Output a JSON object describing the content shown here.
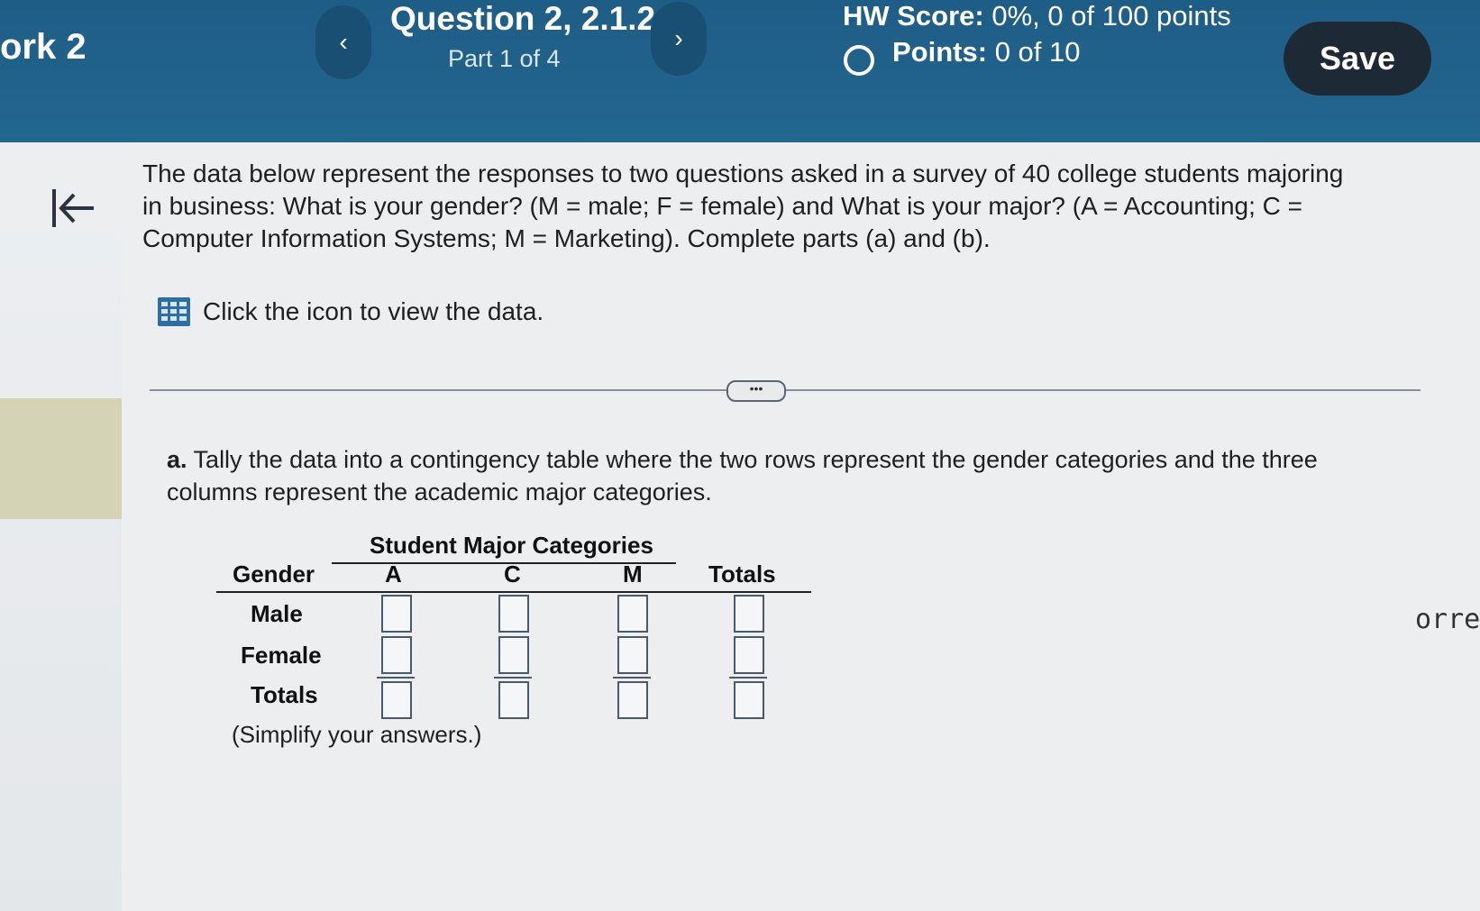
{
  "header": {
    "hw_name": "ork 2",
    "question_title": "Question 2, 2.1.2",
    "part": "Part 1 of 4",
    "hw_score_label": "HW Score:",
    "hw_score_value": "0%, 0 of 100 points",
    "points_label": "Points:",
    "points_value": "0 of 10",
    "save_label": "Save",
    "prev_label": "‹",
    "next_label": "›"
  },
  "question": {
    "intro": "The data below represent the responses to two questions asked in a survey of 40 college students majoring in business: What is your gender? (M = male; F = female) and What is your major? (A = Accounting; C = Computer Information Systems; M = Marketing). Complete parts (a) and (b).",
    "data_link": "Click the icon to view the data.",
    "expand_label": "•••",
    "part_a_letter": "a.",
    "part_a_text": "Tally the data into a contingency table where the two rows represent the gender categories and the three columns represent the academic major categories.",
    "simplify": "(Simplify your answers.)"
  },
  "table": {
    "group_header": "Student Major Categories",
    "row_header": "Gender",
    "columns": [
      "A",
      "C",
      "M",
      "Totals"
    ],
    "rows": [
      "Male",
      "Female",
      "Totals"
    ]
  },
  "side": {
    "cut_text": "orrec"
  },
  "icons": [
    "back-to-start-icon",
    "data-table-icon",
    "circle-status-icon"
  ]
}
